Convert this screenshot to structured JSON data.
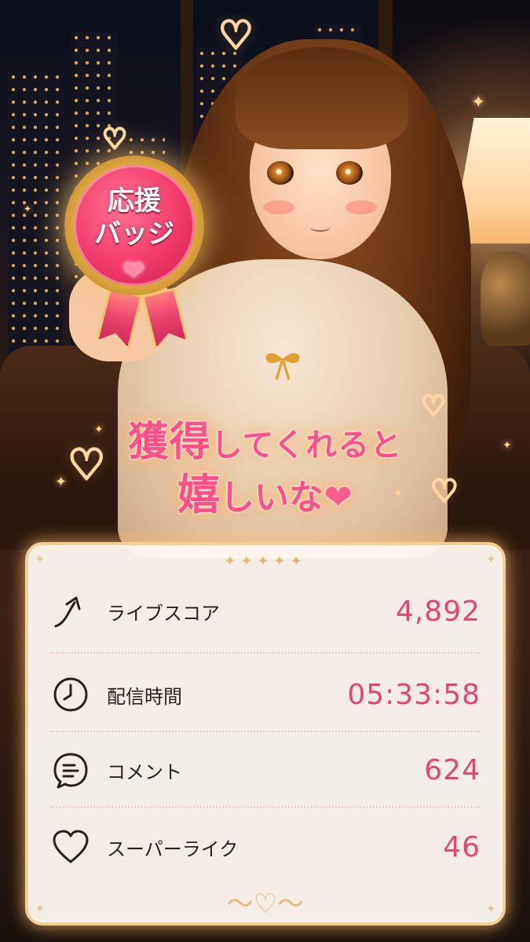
{
  "badge": {
    "line1": "応援",
    "line2": "バッジ"
  },
  "headline": {
    "line1_big": "獲得",
    "line1_rest": "してくれると",
    "line2_big": "嬉",
    "line2_rest": "しいな"
  },
  "stats": [
    {
      "label": "ライブスコア",
      "value": "4,892",
      "icon": "arrow-up-icon"
    },
    {
      "label": "配信時間",
      "value": "05:33:58",
      "icon": "clock-icon"
    },
    {
      "label": "コメント",
      "value": "624",
      "icon": "comment-icon"
    },
    {
      "label": "スーパーライク",
      "value": "46",
      "icon": "heart-icon"
    }
  ],
  "colors": {
    "accent": "#e6456f",
    "badge": "#f23a6b",
    "gold": "#f2cf9a"
  }
}
